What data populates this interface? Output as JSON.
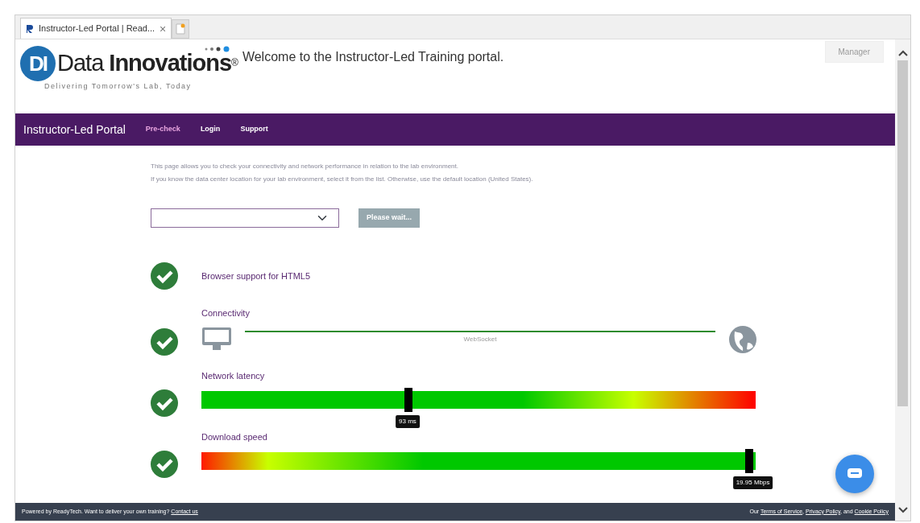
{
  "browser": {
    "tabs": [
      {
        "title": "Instructor-Led Portal | Read...",
        "close": "×",
        "selected": true
      }
    ]
  },
  "header": {
    "logo": {
      "mark": "DI",
      "name_plain": "Data ",
      "name_bold": "Innovations",
      "registered": "®",
      "tagline": "Delivering Tomorrow's Lab, Today"
    },
    "welcome": "Welcome to the Instructor-Led Training portal.",
    "manager_button": "Manager"
  },
  "navbar": {
    "brand": "Instructor-Led Portal",
    "links": [
      {
        "label": "Pre-check",
        "selected": true
      },
      {
        "label": "Login",
        "selected": false
      },
      {
        "label": "Support",
        "selected": false
      }
    ]
  },
  "intro": [
    "This page allows you to check your connectivity and network performance in relation to the lab environment.",
    "If you know the data center location for your lab environment, select it from the list. Otherwise, use the default location (United States)."
  ],
  "wait_button": {
    "label": "Please wait...",
    "disabled": true
  },
  "checks": [
    {
      "kind": "simple",
      "label": "Browser support for HTML5",
      "passed": true
    },
    {
      "kind": "connection",
      "label": "Connectivity",
      "passed": true,
      "link_label": "WebSocket"
    },
    {
      "kind": "meter",
      "label": "Network latency",
      "passed": true,
      "reversed": false,
      "level": 0.372,
      "reading": "93 ms"
    },
    {
      "kind": "meter",
      "label": "Download speed",
      "passed": true,
      "reversed": true,
      "level": 0.995,
      "reading": "19.95 Mbps"
    }
  ],
  "footer": {
    "left": "Powered by ReadyTech. Want to deliver your own training?",
    "contact_link": "Contact us",
    "right_prefix": "Our",
    "terms": "Terms of Service",
    "sep": ",",
    "privacy": "Privacy Policy",
    "and": ", and",
    "cookie": "Cookie Policy"
  }
}
